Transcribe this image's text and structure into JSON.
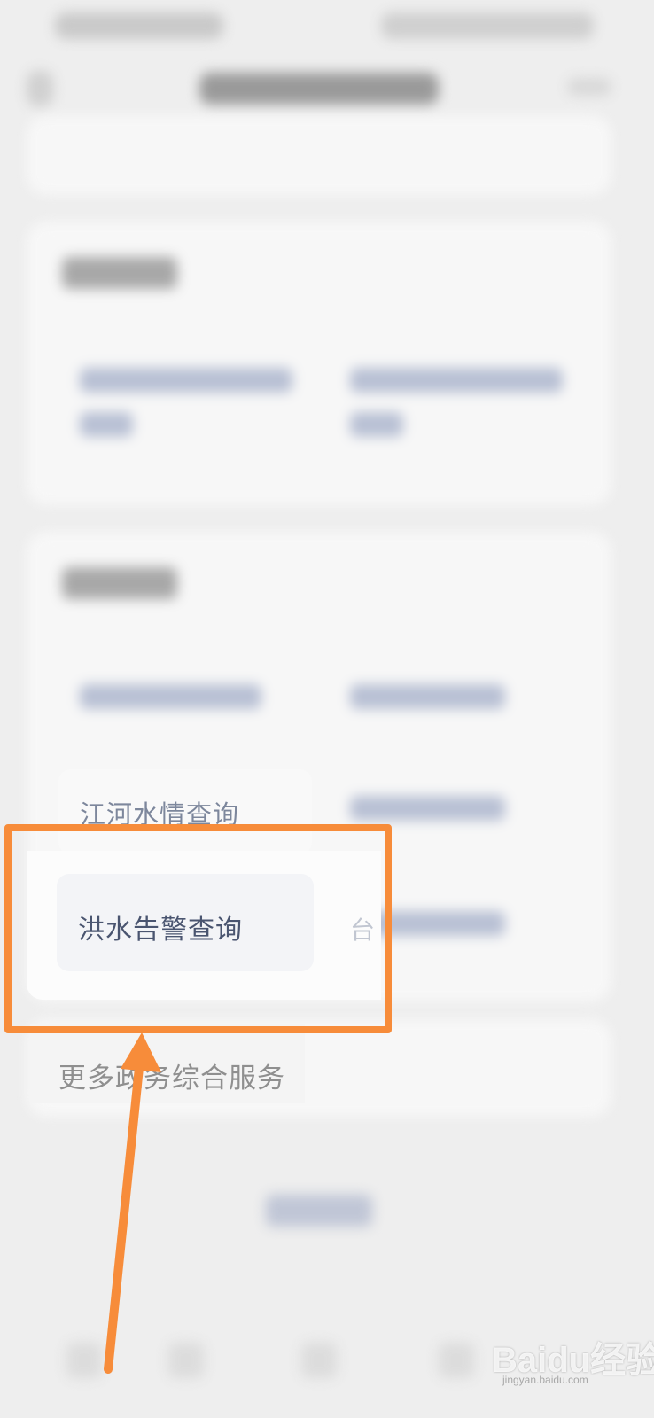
{
  "items": {
    "river_label": "江河水情查询",
    "flood_label": "洪水告警查询"
  },
  "more_services_label": "更多政务综合服务",
  "partial_glyph": "台",
  "watermark": {
    "main": "Baidu经验",
    "sub": "jingyan.baidu.com"
  },
  "colors": {
    "highlight": "#f78c3a",
    "arrow": "#f78c3a"
  }
}
